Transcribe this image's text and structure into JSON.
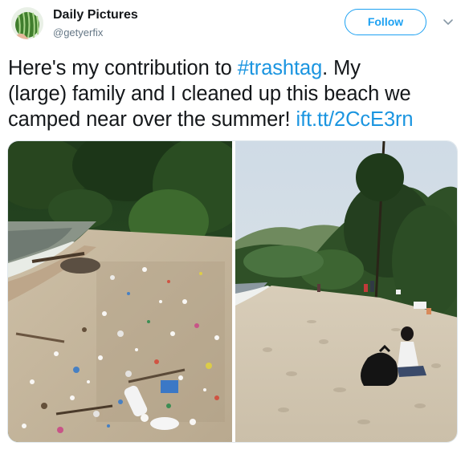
{
  "author": {
    "display_name": "Daily Pictures",
    "handle": "@getyerfix",
    "avatar_icon": "watermelon-icon"
  },
  "actions": {
    "follow_label": "Follow",
    "caret_icon": "chevron-down-icon"
  },
  "tweet": {
    "line1_text": "Here's my contribution to ",
    "hashtag": "#trashtag",
    "line1_rest": ". My",
    "line2_text": "(large) family and I cleaned up this beach we",
    "line3_text": "camped near over the summer! ",
    "link": "ift.tt/2CcE3rn"
  },
  "media": {
    "photos": [
      {
        "subject": "beach covered in trash"
      },
      {
        "subject": "cleaned beach with people and trash bags"
      }
    ]
  },
  "colors": {
    "accent": "#1da1f2",
    "link": "#1b95e0",
    "text": "#14171a",
    "secondary_text": "#657786"
  }
}
